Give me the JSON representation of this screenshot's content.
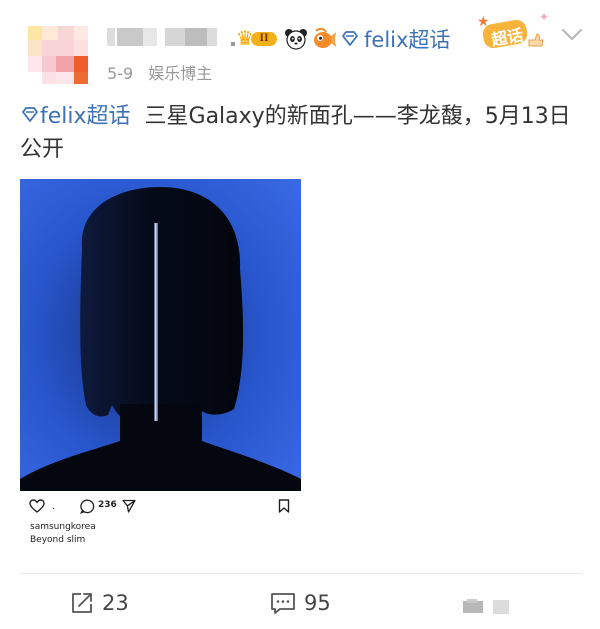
{
  "header": {
    "level_badge": "II",
    "topic_prefix": "felix超话",
    "topic_badge": "超话",
    "date": "5-9",
    "role": "娱乐博主"
  },
  "post": {
    "topic_link": "felix超话",
    "text": "三星Galaxy的新面孔——李龙馥，5月13日公开"
  },
  "image": {
    "comment_count": "236",
    "dot": ".",
    "username": "samsungkorea",
    "caption": "Beyond slim"
  },
  "actions": {
    "share_count": "23",
    "comment_count": "95"
  },
  "colors": {
    "accent": "#3d72b8",
    "meta_gray": "#999999",
    "badge_orange": "#f7b33a"
  }
}
